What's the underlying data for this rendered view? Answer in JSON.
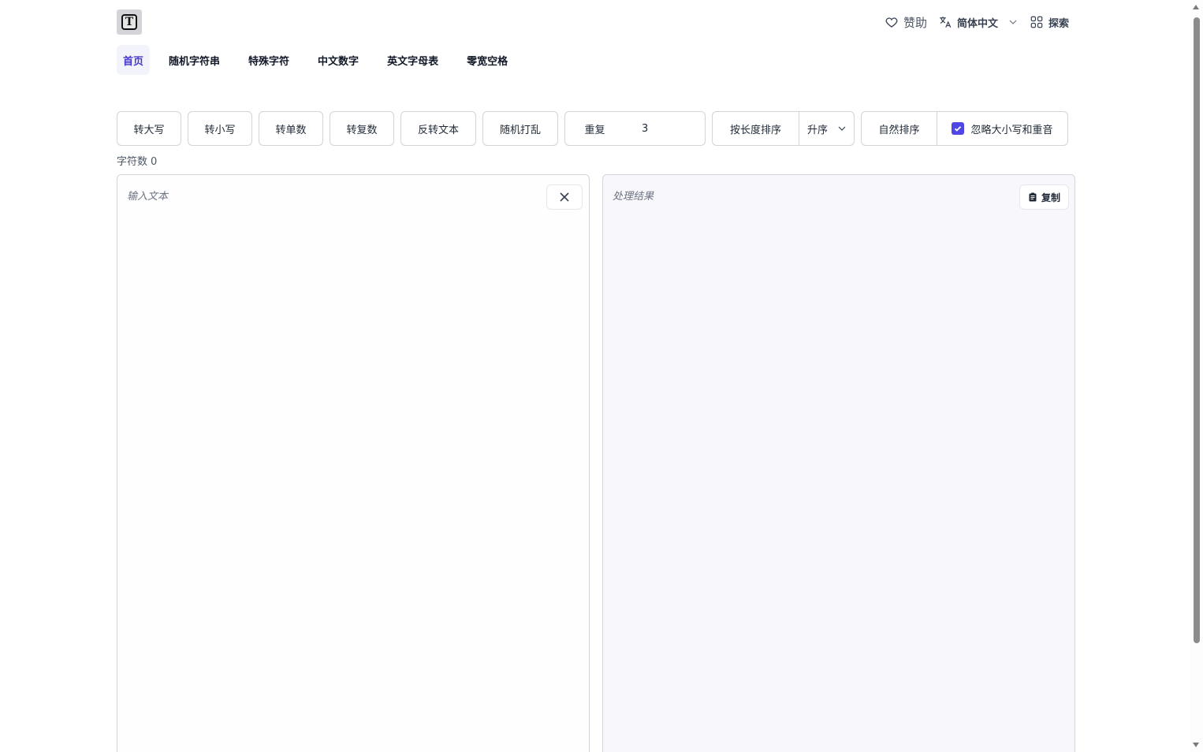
{
  "header": {
    "logo_letter": "T",
    "sponsor_label": "赞助",
    "language_label": "简体中文",
    "explore_label": "探索"
  },
  "nav": {
    "items": [
      {
        "label": "首页",
        "active": true
      },
      {
        "label": "随机字符串"
      },
      {
        "label": "特殊字符"
      },
      {
        "label": "中文数字"
      },
      {
        "label": "英文字母表"
      },
      {
        "label": "零宽空格"
      }
    ]
  },
  "toolbar": {
    "uppercase": "转大写",
    "lowercase": "转小写",
    "singular": "转单数",
    "plural": "转复数",
    "reverse": "反转文本",
    "shuffle": "随机打乱",
    "repeat": "重复",
    "repeat_count": "3",
    "sort_by_length": "按长度排序",
    "sort_order": "升序",
    "natural_sort": "自然排序",
    "ignore_case_label": "忽略大小写和重音",
    "ignore_case_checked": true
  },
  "stats": {
    "char_count_label": "字符数",
    "char_count_value": "0"
  },
  "input_panel": {
    "placeholder": "输入文本"
  },
  "output_panel": {
    "placeholder": "处理结果",
    "copy_label": "复制"
  },
  "colors": {
    "accent": "#4f46e5",
    "active_nav_text": "#4338ca"
  }
}
